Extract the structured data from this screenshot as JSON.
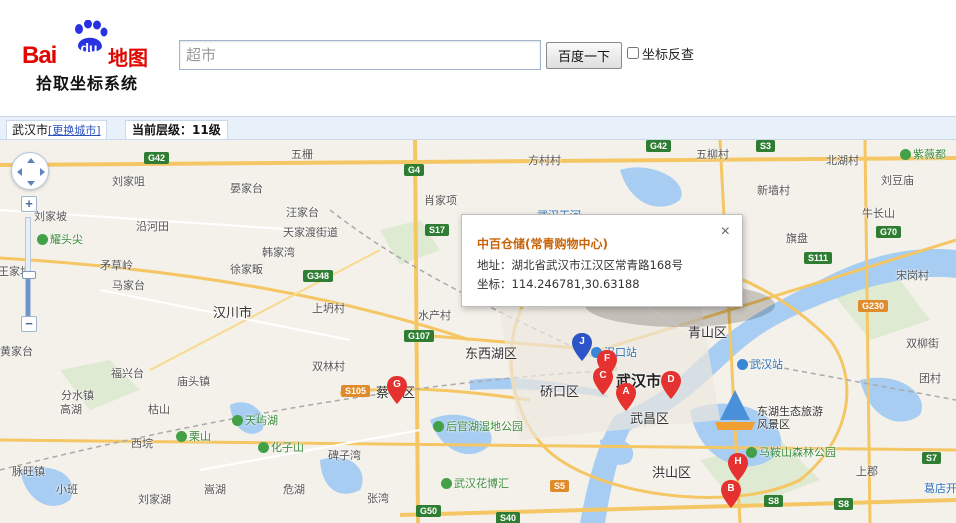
{
  "header": {
    "logo_brand": "Bai",
    "logo_du": "du",
    "logo_map": "地图",
    "logo_subtitle": "拾取坐标系统",
    "search_value": "",
    "search_placeholder": "超市",
    "search_button": "百度一下",
    "reverse_label": "坐标反查"
  },
  "statusbar": {
    "city": "武汉市",
    "change_city": "[更换城市]",
    "zoom_level_text": "当前层级：11级"
  },
  "info_window": {
    "title": "中百仓储(常青购物中心)",
    "address": "地址：湖北省武汉市江汉区常青路168号",
    "coords": "坐标：114.246781,30.63188",
    "close": "×"
  },
  "markers": [
    "J",
    "F",
    "C",
    "A",
    "D",
    "G",
    "H",
    "B"
  ],
  "map_labels": {
    "districts": [
      "汉川市",
      "东西湖区",
      "硚口区",
      "武汉市",
      "武昌区",
      "青山区",
      "洪山区",
      "蔡甸区"
    ],
    "places": [
      "刘家咀",
      "晏家台",
      "五栅",
      "肖家项",
      "方村村",
      "北湖村",
      "五柳村",
      "新墙村",
      "汪家台",
      "天家渡街道",
      "韩家湾",
      "徐家畈",
      "矛草岭",
      "马家台",
      "沿河田",
      "刘家坡",
      "耀头尖",
      "王家坝",
      "水产村",
      "上坍村",
      "福兴台",
      "双林村",
      "庙头镇",
      "分水镇",
      "高湖",
      "枯山",
      "栗山",
      "西垸",
      "脉旺镇",
      "小班",
      "刘家湖",
      "嵩湖",
      "化子山",
      "危湖",
      "碑子湾",
      "张湾",
      "天屿湖",
      "后官湖湿地公园",
      "武汉花博汇",
      "东湖生态旅游风景区",
      "马鞍山森林公园",
      "武汉站",
      "汉口站",
      "武汉天河",
      "紫薇都",
      "刘豆庙",
      "牛长山",
      "宋岗村",
      "双柳街",
      "团村",
      "葛店开",
      "旗盘",
      "黄家台",
      "上郡"
    ],
    "highways": [
      "G42",
      "G4",
      "S17",
      "G348",
      "G107",
      "S105",
      "G50",
      "S40",
      "S5",
      "G42",
      "S3",
      "G70",
      "S111",
      "G230",
      "S7",
      "S8",
      "S8"
    ]
  },
  "map_controls": {
    "zoom_in": "+",
    "zoom_out": "−",
    "zoom_fraction": 0.42
  }
}
